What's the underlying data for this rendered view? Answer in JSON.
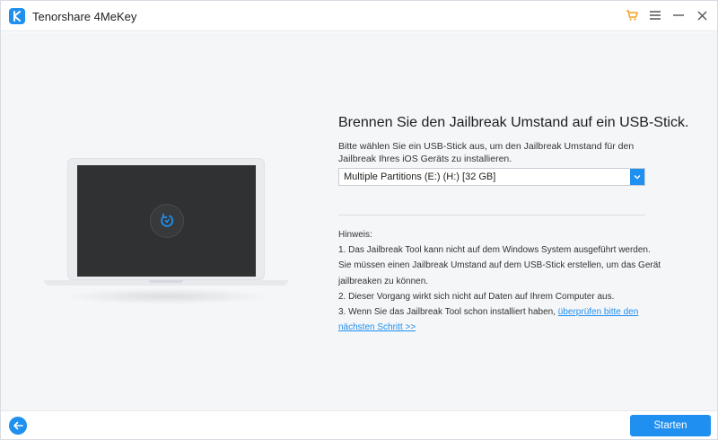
{
  "app": {
    "title": "Tenorshare 4MeKey",
    "logo_icon": "k-logo-icon",
    "brand_color": "#1f8ff0"
  },
  "titlebar": {
    "icons": [
      "cart-icon",
      "menu-icon",
      "minimize-icon",
      "close-icon"
    ]
  },
  "main": {
    "heading": "Brennen Sie den Jailbreak Umstand auf ein USB-Stick.",
    "description": "Bitte wählen Sie ein USB-Stick aus, um den Jailbreak Umstand für den Jailbreak Ihres iOS Geräts zu installieren.",
    "usb_select": {
      "selected": "Multiple Partitions (E:) (H:) [32 GB]"
    },
    "hint": {
      "title": "Hinweis:",
      "lines": [
        "1. Das Jailbreak Tool kann nicht auf dem Windows System ausgeführt werden.",
        "Sie müssen einen Jailbreak Umstand auf dem USB-Stick erstellen, um das Gerät",
        "jailbreaken zu können.",
        "2. Dieser Vorgang wirkt sich nicht auf Daten auf Ihrem Computer aus."
      ],
      "line3_prefix": "3. Wenn Sie das Jailbreak Tool schon installiert haben, ",
      "link_part1": "überprüfen bitte den",
      "link_part2": "nächsten Schritt >>"
    }
  },
  "footer": {
    "back_icon": "arrow-left-icon",
    "start_label": "Starten"
  }
}
